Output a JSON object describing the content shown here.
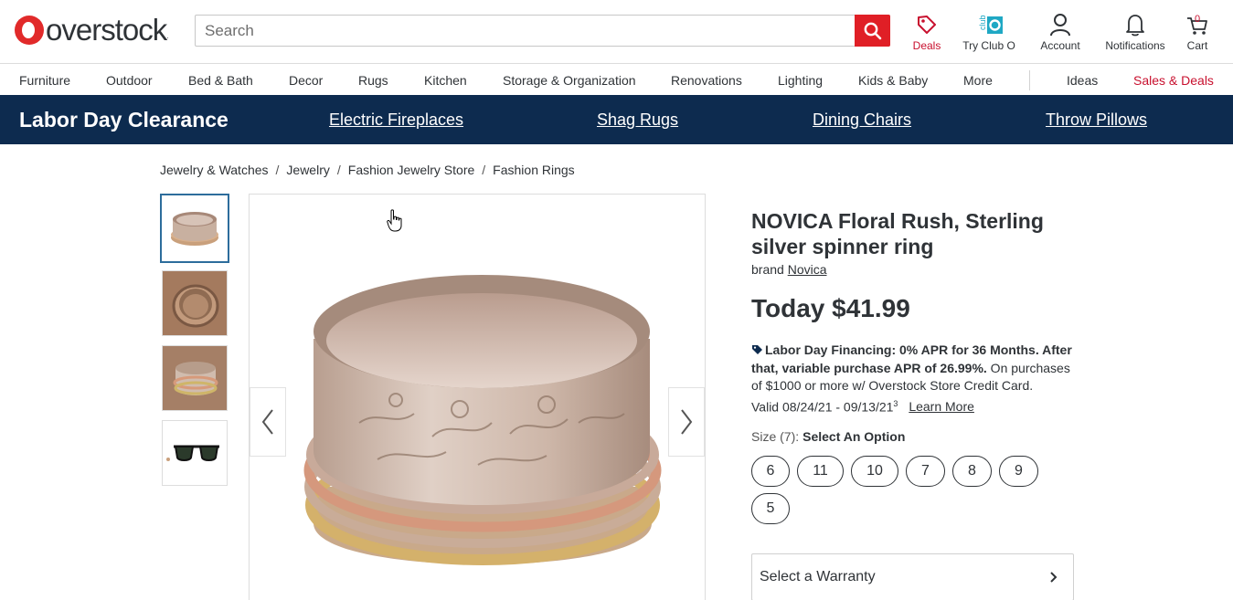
{
  "header": {
    "logo_text": "overstock",
    "logo_tm": ".",
    "search_placeholder": "Search",
    "deals": "Deals",
    "club_o": "Try Club O",
    "club_badge": "club",
    "account": "Account",
    "notifications": "Notifications",
    "cart": "Cart",
    "cart_count": "0"
  },
  "nav": {
    "items": [
      "Furniture",
      "Outdoor",
      "Bed & Bath",
      "Decor",
      "Rugs",
      "Kitchen",
      "Storage & Organization",
      "Renovations",
      "Lighting",
      "Kids & Baby",
      "More"
    ],
    "ideas": "Ideas",
    "sales": "Sales & Deals"
  },
  "banner": {
    "title": "Labor Day Clearance",
    "links": [
      "Electric Fireplaces",
      "Shag Rugs",
      "Dining Chairs",
      "Throw Pillows"
    ]
  },
  "breadcrumb": [
    "Jewelry & Watches",
    "Jewelry",
    "Fashion Jewelry Store",
    "Fashion Rings"
  ],
  "product": {
    "title": "NOVICA Floral Rush, Sterling silver spinner ring",
    "brand_label": "brand",
    "brand_name": "Novica",
    "price": "Today $41.99",
    "financing_bold": "Labor Day Financing: 0% APR for 36 Months. After that, variable purchase APR of 26.99%.",
    "financing_text": " On purchases of $1000 or more w/ Overstock Store Credit Card.",
    "valid": "Valid 08/24/21 - 09/13/21",
    "valid_sup": "3",
    "learn_more": "Learn More",
    "size_label": "Size (7):",
    "size_prompt": "Select An Option",
    "sizes": [
      "6",
      "11",
      "10",
      "7",
      "8",
      "9",
      "5"
    ],
    "warranty": "Select a Warranty"
  },
  "colors": {
    "brand_red": "#e01f26",
    "banner_navy": "#0d2b4f",
    "deals_red": "#c8102e",
    "club_teal": "#1fa8c4"
  }
}
